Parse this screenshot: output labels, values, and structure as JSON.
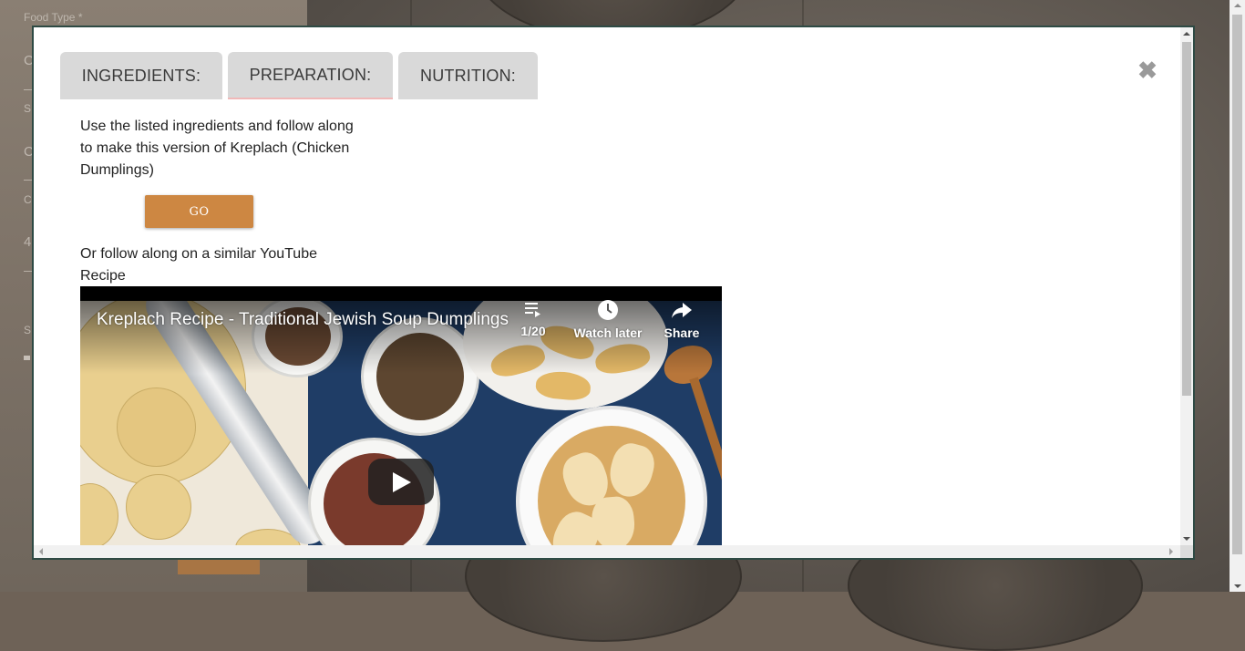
{
  "background_form": {
    "food_type_label": "Food Type *",
    "field_glyphs": [
      "C",
      "S",
      "C",
      "C",
      "4",
      "S"
    ]
  },
  "modal": {
    "tabs": [
      {
        "label": "INGREDIENTS:"
      },
      {
        "label": "PREPARATION:"
      },
      {
        "label": "NUTRITION:"
      }
    ],
    "close_glyph": "✖",
    "intro_text": "Use the listed ingredients and follow along to make this version of Kreplach (Chicken Dumplings)",
    "go_button_label": "GO",
    "alt_text": "Or follow along on a similar YouTube Recipe",
    "video": {
      "title": "Kreplach Recipe - Traditional Jewish Soup Dumplings",
      "playlist_count": "1/20",
      "watch_later_label": "Watch later",
      "share_label": "Share"
    }
  },
  "colors": {
    "go_button": "#cd8742",
    "modal_border": "#2e4a44",
    "tab_bg": "#d9d9d9"
  }
}
